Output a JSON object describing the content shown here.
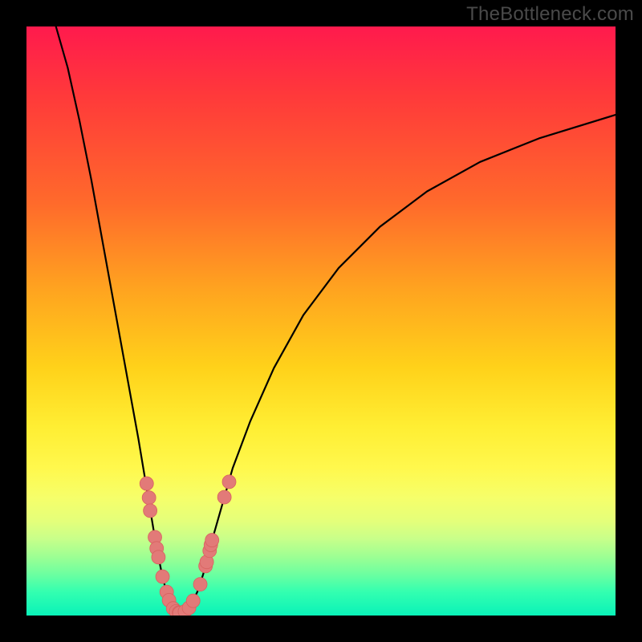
{
  "watermark": "TheBottleneck.com",
  "colors": {
    "curve_stroke": "#000000",
    "marker_fill": "#e27a78",
    "marker_stroke": "#d86260",
    "frame_bg": "#000000"
  },
  "chart_data": {
    "type": "line",
    "title": "",
    "xlabel": "",
    "ylabel": "",
    "xlim": [
      0,
      100
    ],
    "ylim": [
      0,
      100
    ],
    "grid": false,
    "legend": false,
    "curve": [
      {
        "x": 5,
        "y": 100
      },
      {
        "x": 7,
        "y": 93
      },
      {
        "x": 9,
        "y": 84
      },
      {
        "x": 11,
        "y": 74
      },
      {
        "x": 13,
        "y": 63
      },
      {
        "x": 15,
        "y": 52
      },
      {
        "x": 17,
        "y": 41
      },
      {
        "x": 19,
        "y": 30
      },
      {
        "x": 20,
        "y": 24
      },
      {
        "x": 21,
        "y": 18
      },
      {
        "x": 22,
        "y": 12
      },
      {
        "x": 23,
        "y": 7
      },
      {
        "x": 24,
        "y": 3
      },
      {
        "x": 25,
        "y": 1
      },
      {
        "x": 26,
        "y": 0.4
      },
      {
        "x": 27,
        "y": 0.8
      },
      {
        "x": 28,
        "y": 2
      },
      {
        "x": 29,
        "y": 4
      },
      {
        "x": 30,
        "y": 7
      },
      {
        "x": 31,
        "y": 11
      },
      {
        "x": 33,
        "y": 18
      },
      {
        "x": 35,
        "y": 25
      },
      {
        "x": 38,
        "y": 33
      },
      {
        "x": 42,
        "y": 42
      },
      {
        "x": 47,
        "y": 51
      },
      {
        "x": 53,
        "y": 59
      },
      {
        "x": 60,
        "y": 66
      },
      {
        "x": 68,
        "y": 72
      },
      {
        "x": 77,
        "y": 77
      },
      {
        "x": 87,
        "y": 81
      },
      {
        "x": 100,
        "y": 85
      }
    ],
    "markers": [
      {
        "x": 20.4,
        "y": 22.4
      },
      {
        "x": 20.8,
        "y": 20.0
      },
      {
        "x": 21.0,
        "y": 17.8
      },
      {
        "x": 21.8,
        "y": 13.3
      },
      {
        "x": 22.1,
        "y": 11.4
      },
      {
        "x": 22.4,
        "y": 9.9
      },
      {
        "x": 23.1,
        "y": 6.6
      },
      {
        "x": 23.8,
        "y": 4.0
      },
      {
        "x": 24.2,
        "y": 2.6
      },
      {
        "x": 24.9,
        "y": 1.2
      },
      {
        "x": 25.4,
        "y": 0.7
      },
      {
        "x": 25.9,
        "y": 0.5
      },
      {
        "x": 26.0,
        "y": 0.4
      },
      {
        "x": 26.9,
        "y": 0.7
      },
      {
        "x": 27.6,
        "y": 1.3
      },
      {
        "x": 28.3,
        "y": 2.5
      },
      {
        "x": 29.5,
        "y": 5.3
      },
      {
        "x": 30.4,
        "y": 8.4
      },
      {
        "x": 30.6,
        "y": 9.1
      },
      {
        "x": 31.1,
        "y": 11.0
      },
      {
        "x": 31.3,
        "y": 12.0
      },
      {
        "x": 31.5,
        "y": 12.8
      },
      {
        "x": 33.6,
        "y": 20.1
      },
      {
        "x": 34.4,
        "y": 22.7
      }
    ],
    "marker_radius_px": 8.5
  }
}
